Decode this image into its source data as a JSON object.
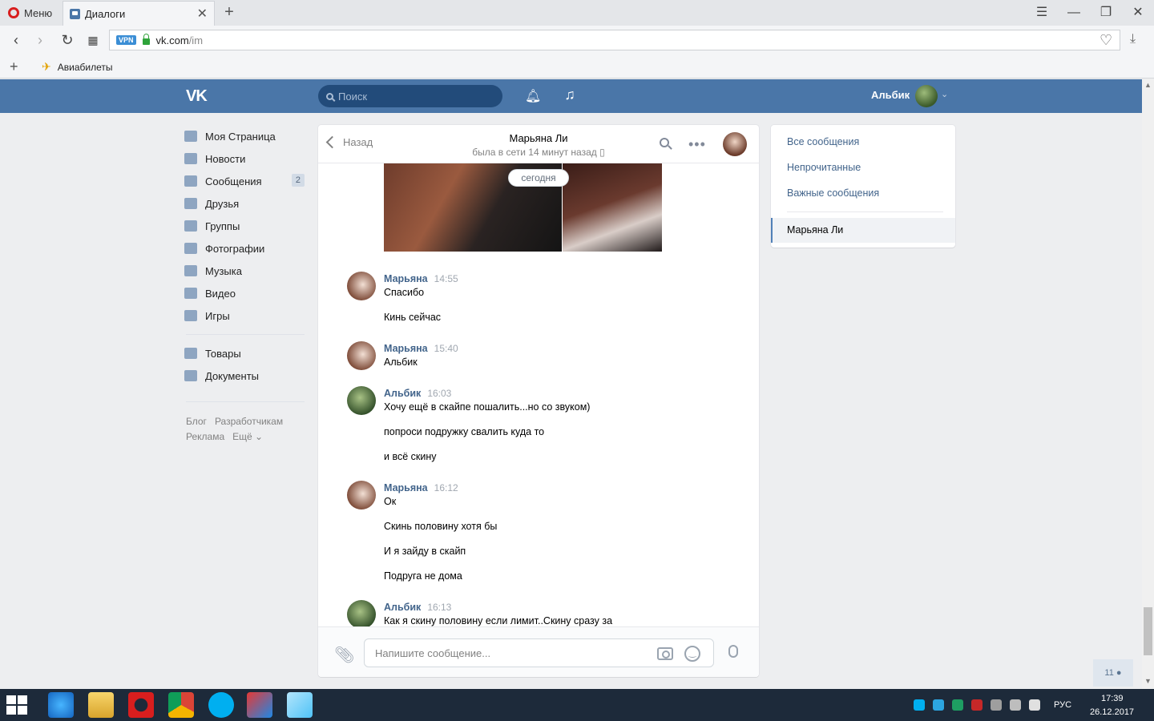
{
  "browser": {
    "menu_label": "Меню",
    "tab_title": "Диалоги",
    "url_host": "vk.com",
    "url_path": "/im",
    "vpn_badge": "VPN",
    "bookmark_label": "Авиабилеты"
  },
  "header": {
    "logo": "VK",
    "search_placeholder": "Поиск",
    "user_name": "Альбик",
    "brand_color": "#4a76a8"
  },
  "sidebar": {
    "items": [
      {
        "label": "Моя Страница",
        "icon": "home-icon"
      },
      {
        "label": "Новости",
        "icon": "news-icon"
      },
      {
        "label": "Сообщения",
        "icon": "messages-icon",
        "count": "2"
      },
      {
        "label": "Друзья",
        "icon": "friend-icon"
      },
      {
        "label": "Группы",
        "icon": "groups-icon"
      },
      {
        "label": "Фотографии",
        "icon": "camera-icon"
      },
      {
        "label": "Музыка",
        "icon": "music-icon"
      },
      {
        "label": "Видео",
        "icon": "video-icon"
      },
      {
        "label": "Игры",
        "icon": "gamepad-icon"
      },
      {
        "label": "Товары",
        "icon": "bag-icon"
      },
      {
        "label": "Документы",
        "icon": "document-icon"
      }
    ],
    "footer": {
      "blog": "Блог",
      "developers": "Разработчикам",
      "ads": "Реклама",
      "more": "Ещё"
    }
  },
  "chat": {
    "back_label": "Назад",
    "peer_name": "Марьяна Ли",
    "peer_status": "была в сети 14 минут назад",
    "date_divider": "сегодня",
    "messages": [
      {
        "author": "Марьяна",
        "time": "14:55",
        "lines": [
          "Спасибо",
          "Кинь сейчас"
        ]
      },
      {
        "author": "Марьяна",
        "time": "15:40",
        "lines": [
          "Альбик"
        ]
      },
      {
        "author": "Альбик",
        "time": "16:03",
        "lines": [
          "Хочу ещё в скайпе пошалить...но со звуком)",
          "попроси подружку свалить куда то",
          "и всё скину"
        ]
      },
      {
        "author": "Марьяна",
        "time": "16:12",
        "lines": [
          "Ок",
          "Скинь половину хотя бы",
          "И я зайду в скайп",
          "Подруга не дома"
        ]
      },
      {
        "author": "Альбик",
        "time": "16:13",
        "lines": [
          "Как я скину половину если лимит..Скину сразу за"
        ]
      }
    ],
    "composer_placeholder": "Напишите сообщение..."
  },
  "filters": {
    "items": [
      "Все сообщения",
      "Непрочитанные",
      "Важные сообщения"
    ],
    "active": "Марьяна Ли"
  },
  "online_count": "11",
  "taskbar": {
    "lang": "РУС",
    "time": "17:39",
    "date": "26.12.2017"
  }
}
